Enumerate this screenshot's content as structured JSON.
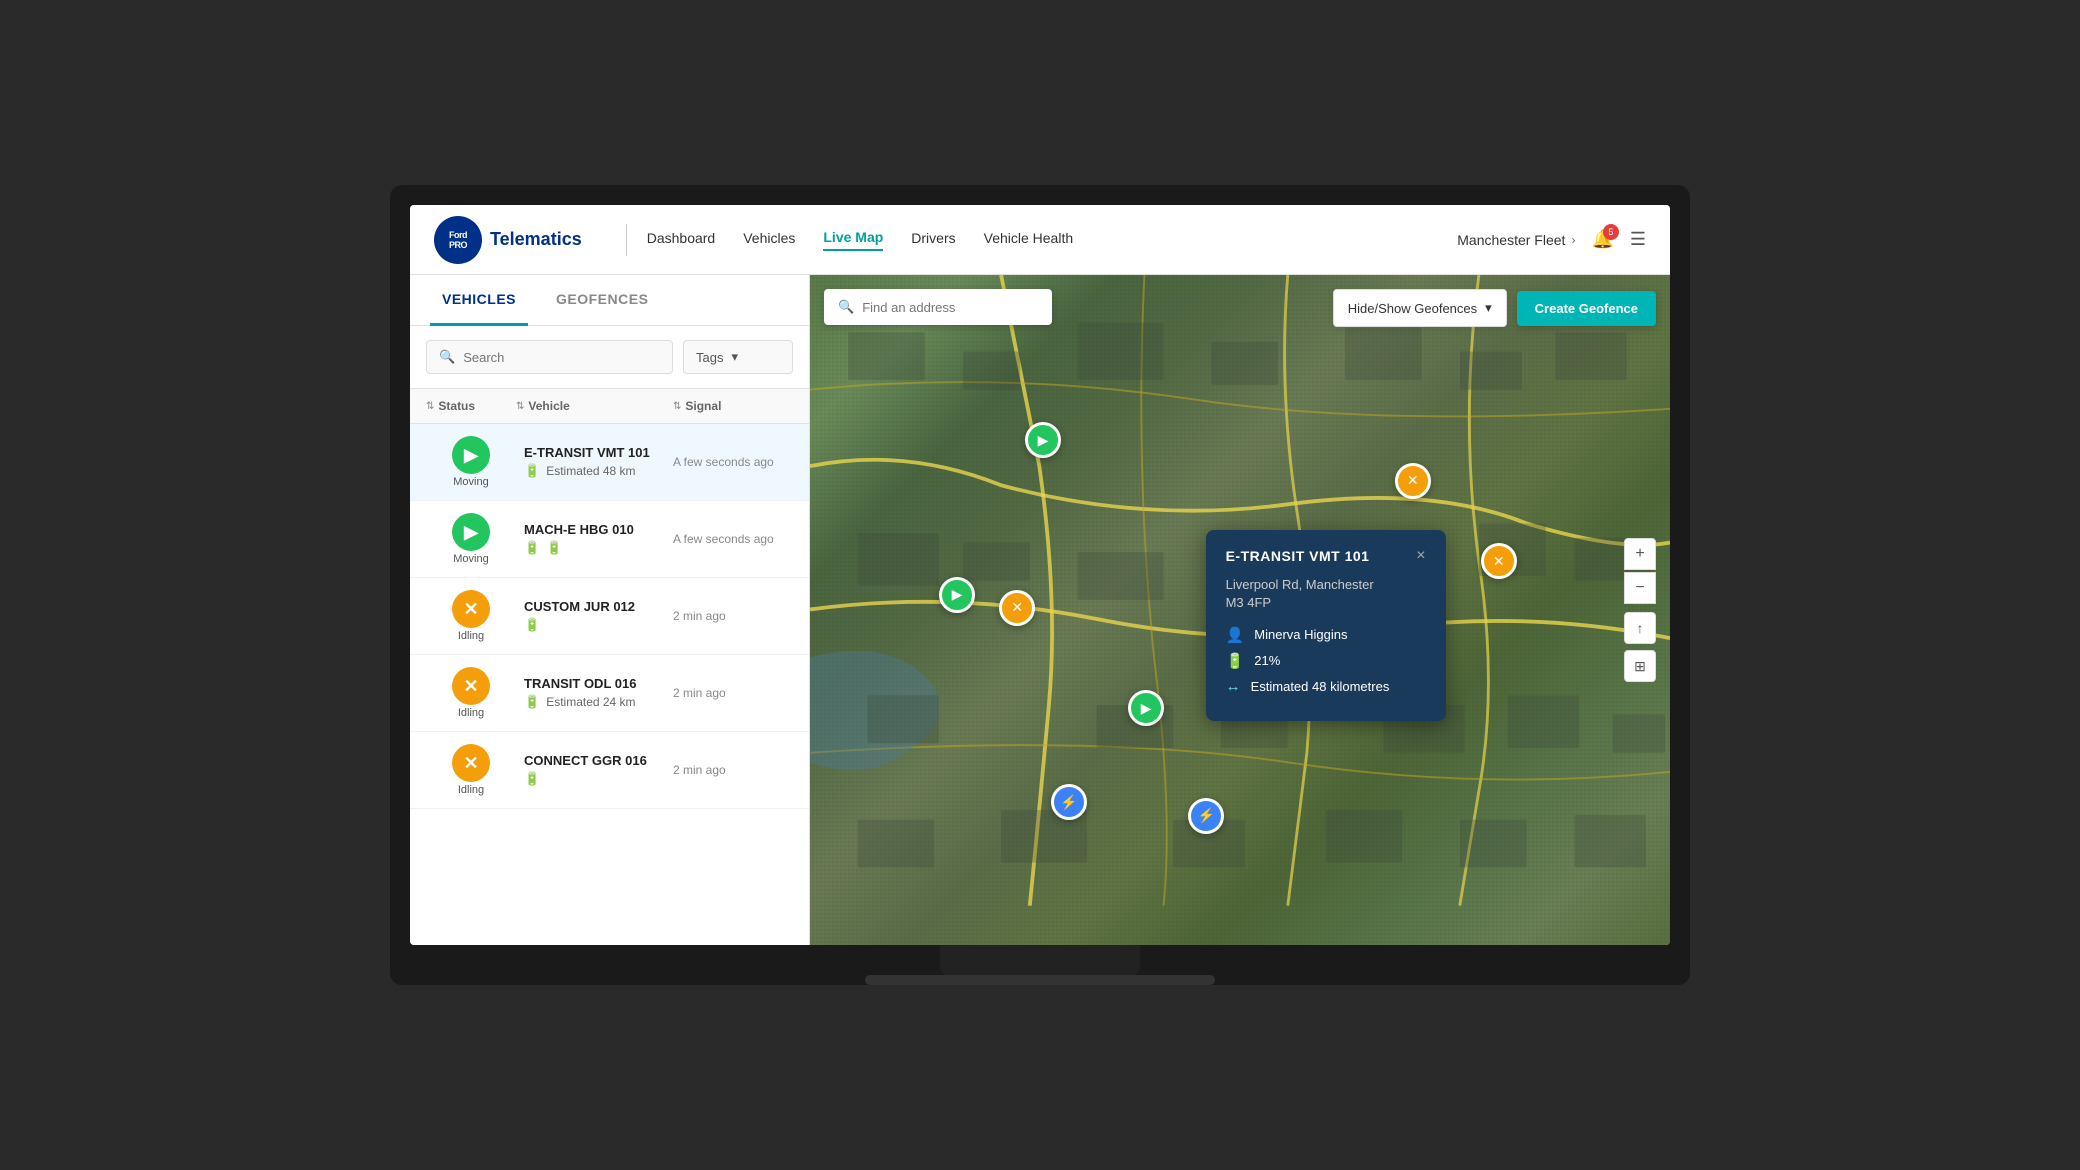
{
  "app": {
    "brand": "Telematics",
    "logo_text": "Ford PRO"
  },
  "nav": {
    "links": [
      {
        "label": "Dashboard",
        "active": false
      },
      {
        "label": "Vehicles",
        "active": false
      },
      {
        "label": "Live Map",
        "active": true
      },
      {
        "label": "Drivers",
        "active": false
      },
      {
        "label": "Vehicle Health",
        "active": false
      }
    ]
  },
  "header": {
    "fleet_name": "Manchester Fleet",
    "notification_count": "5"
  },
  "sidebar": {
    "tabs": [
      {
        "label": "VEHICLES",
        "active": true
      },
      {
        "label": "GEOFENCES",
        "active": false
      }
    ],
    "search_placeholder": "Search",
    "tags_label": "Tags",
    "columns": [
      {
        "label": "Status"
      },
      {
        "label": "Vehicle"
      },
      {
        "label": "Signal"
      }
    ]
  },
  "vehicles": [
    {
      "name": "E-TRANSIT VMT 101",
      "status": "Moving",
      "status_type": "moving",
      "signal": "A few seconds ago",
      "range": "Estimated 48 km",
      "selected": true
    },
    {
      "name": "MACH-E HBG 010",
      "status": "Moving",
      "status_type": "moving",
      "signal": "A few seconds ago",
      "range": "",
      "selected": false
    },
    {
      "name": "CUSTOM JUR 012",
      "status": "Idling",
      "status_type": "idling",
      "signal": "2 min ago",
      "range": "",
      "selected": false
    },
    {
      "name": "TRANSIT ODL 016",
      "status": "Idling",
      "status_type": "idling",
      "signal": "2 min ago",
      "range": "Estimated 24 km",
      "selected": false
    },
    {
      "name": "CONNECT GGR 016",
      "status": "Idling",
      "status_type": "idling",
      "signal": "2 min ago",
      "range": "",
      "selected": false
    }
  ],
  "map": {
    "search_placeholder": "Find an address",
    "geofence_toggle_label": "Hide/Show Geofences",
    "create_geofence_label": "Create Geofence"
  },
  "popup": {
    "title": "E-TRANSIT VMT 101",
    "address_line1": "Liverpool Rd, Manchester",
    "address_line2": "M3 4FP",
    "driver": "Minerva Higgins",
    "battery": "21%",
    "range": "Estimated 48 kilometres",
    "close_label": "×"
  },
  "zoom_controls": {
    "zoom_in": "+",
    "zoom_out": "−",
    "compass": "↑",
    "layers": "⊞"
  }
}
